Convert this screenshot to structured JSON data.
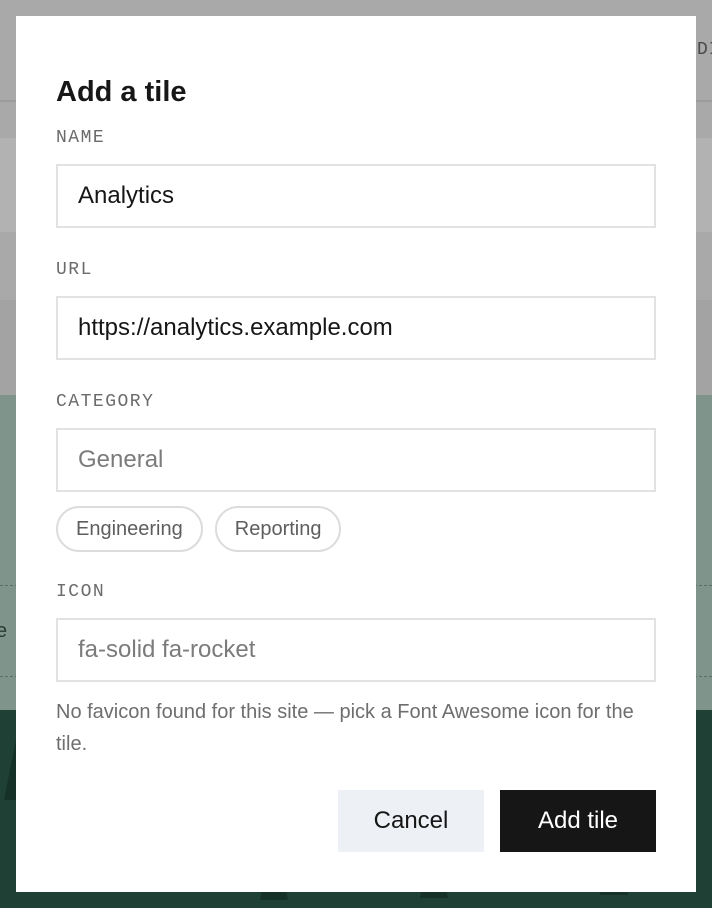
{
  "modal": {
    "title": "Add a tile",
    "fields": {
      "name": {
        "label": "NAME",
        "value": "Analytics"
      },
      "url": {
        "label": "URL",
        "value": "https://analytics.example.com"
      },
      "category": {
        "label": "CATEGORY",
        "placeholder": "General",
        "suggestions": [
          "Engineering",
          "Reporting"
        ]
      },
      "icon": {
        "label": "ICON",
        "placeholder": "fa-solid fa-rocket"
      }
    },
    "help_text": "No favicon found for this site — pick a Font Awesome icon for the tile.",
    "buttons": {
      "cancel": "Cancel",
      "submit": "Add tile"
    }
  },
  "background": {
    "edge_text_top": "DI",
    "edge_text_mid": "e"
  }
}
